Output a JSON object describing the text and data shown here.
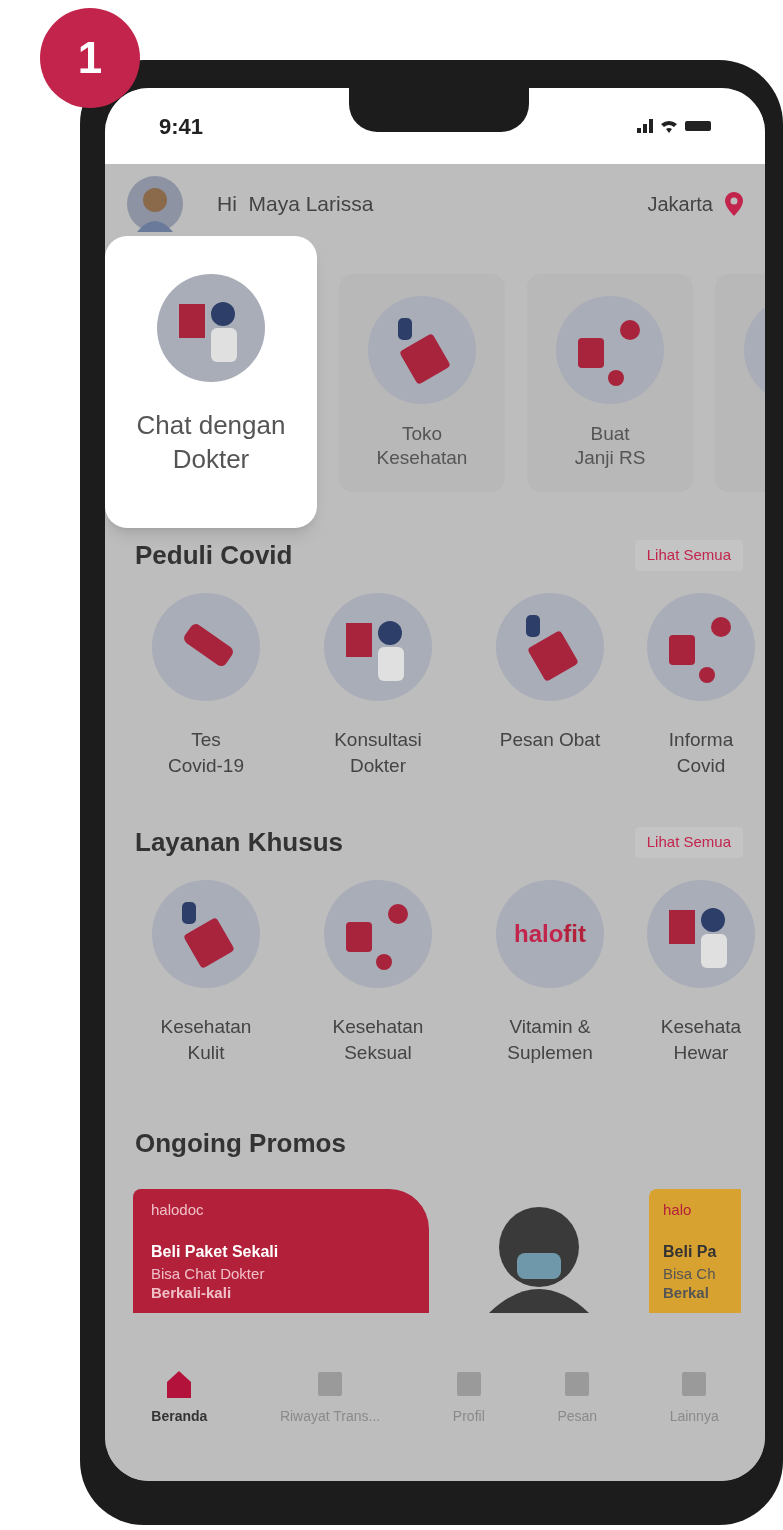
{
  "step_badge": "1",
  "status_bar": {
    "time": "9:41"
  },
  "header": {
    "greeting": "Hi  Maya Larissa",
    "location": "Jakarta"
  },
  "services": [
    {
      "label": "Chat dengan\nDokter",
      "highlighted": true
    },
    {
      "label": "Toko\nKesehatan",
      "highlighted": false
    },
    {
      "label": "Buat\nJanji RS",
      "highlighted": false
    },
    {
      "highlighted": false
    }
  ],
  "sections": [
    {
      "title": "Peduli Covid",
      "link": "Lihat Semua",
      "items": [
        {
          "label": "Tes\nCovid-19",
          "kind": "illustration"
        },
        {
          "label": "Konsultasi\nDokter",
          "kind": "illustration"
        },
        {
          "label": "Pesan Obat",
          "kind": "illustration"
        },
        {
          "label": "Informa\nCovid",
          "kind": "illustration"
        }
      ]
    },
    {
      "title": "Layanan Khusus",
      "link": "Lihat Semua",
      "items": [
        {
          "label": "Kesehatan\nKulit",
          "kind": "illustration"
        },
        {
          "label": "Kesehatan\nSeksual",
          "kind": "illustration"
        },
        {
          "label": "Vitamin &\nSuplemen",
          "kind": "logo",
          "logo": [
            "halo",
            "fit"
          ]
        },
        {
          "label": "Kesehata\nHewar",
          "kind": "illustration"
        }
      ]
    }
  ],
  "promos": {
    "title": "Ongoing Promos",
    "cards": [
      {
        "kind": "banner",
        "color": "#b3203a",
        "brand": "halodoc",
        "headline": "Beli Paket Sekali",
        "lines": [
          "Bisa Chat Dokter",
          "Berkali-kali"
        ]
      },
      {
        "kind": "photo"
      },
      {
        "kind": "banner",
        "color": "#d8a230",
        "brand": "halo",
        "headline": "Beli Pa",
        "lines": [
          "Bisa Ch",
          "Berkal"
        ]
      }
    ]
  },
  "nav": [
    {
      "label": "Beranda",
      "selected": true
    },
    {
      "label": "Riwayat Trans...",
      "selected": false
    },
    {
      "label": "Profil",
      "selected": false
    },
    {
      "label": "Pesan",
      "selected": false
    },
    {
      "label": "Lainnya",
      "selected": false
    }
  ]
}
